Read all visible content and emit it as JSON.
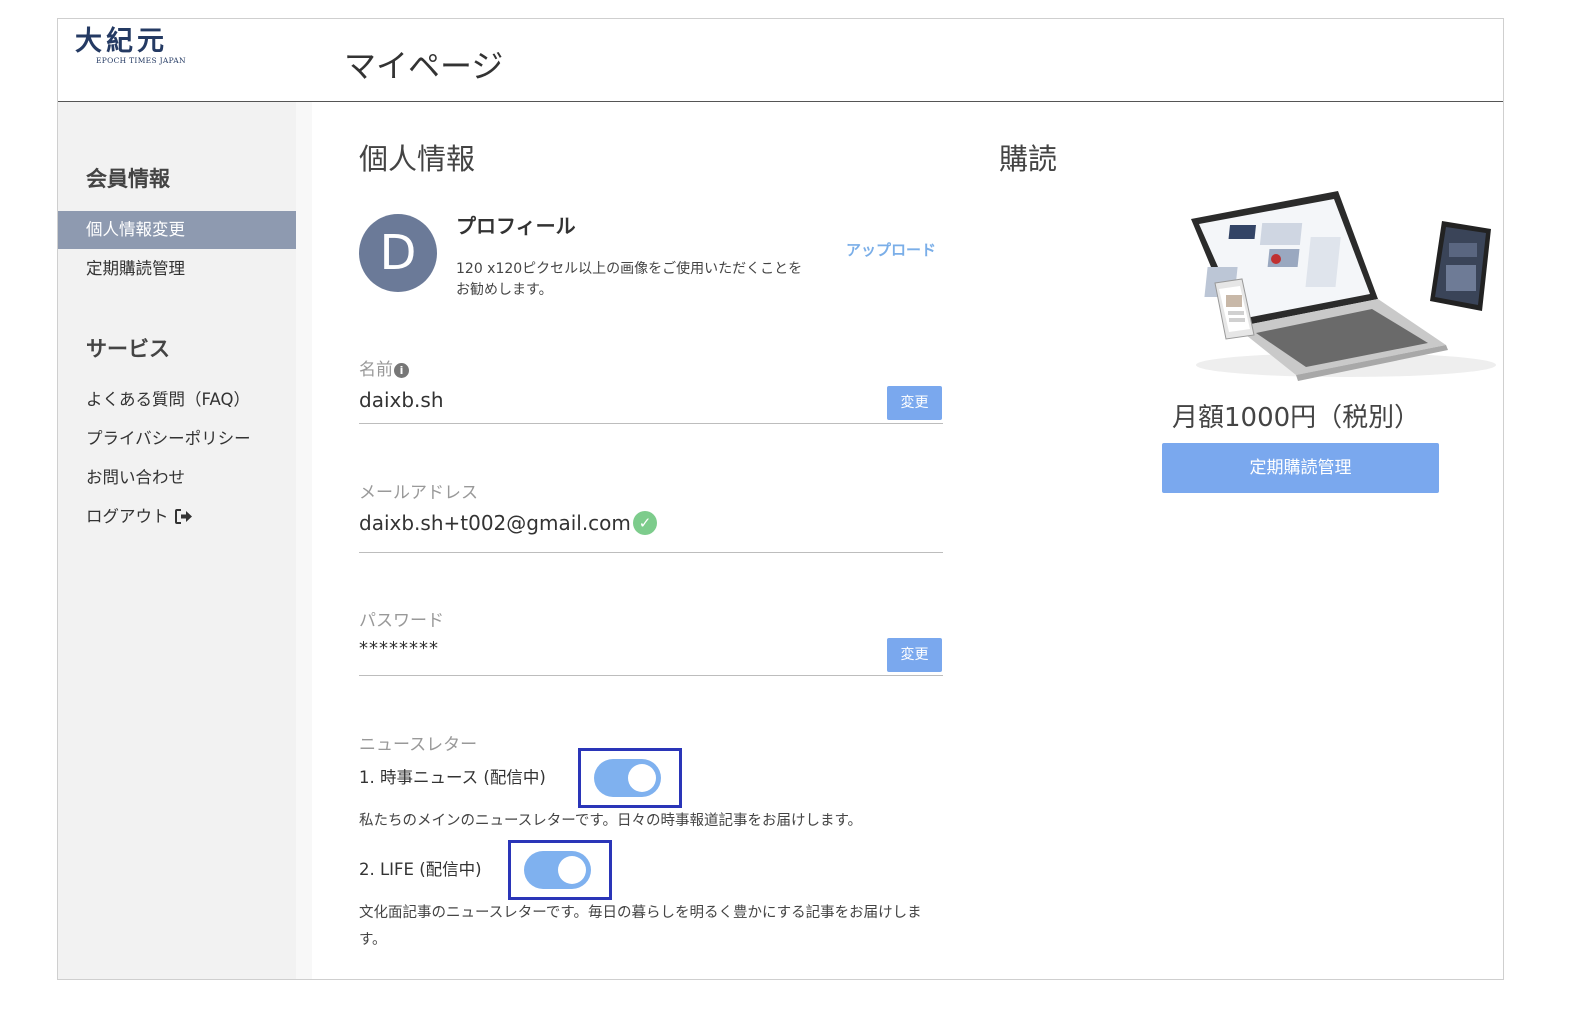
{
  "header": {
    "logo_text": "大紀元",
    "logo_subtext": "EPOCH TIMES JAPAN",
    "page_title": "マイページ"
  },
  "sidebar": {
    "member_heading": "会員情報",
    "member_items": [
      {
        "label": "個人情報変更",
        "active": true
      },
      {
        "label": "定期購読管理",
        "active": false
      }
    ],
    "service_heading": "サービス",
    "service_items": [
      {
        "label": "よくある質問（FAQ）"
      },
      {
        "label": "プライバシーポリシー"
      },
      {
        "label": "お問い合わせ"
      },
      {
        "label": "ログアウト"
      }
    ]
  },
  "personal": {
    "title": "個人情報",
    "avatar_letter": "D",
    "profile_title": "プロフィール",
    "profile_desc": "120 x120ピクセル以上の画像をご使用いただくことをお勧めします。",
    "upload_label": "アップロード",
    "name_label": "名前",
    "name_value": "daixb.sh",
    "change_label": "変更",
    "email_label": "メールアドレス",
    "email_value": "daixb.sh+t002@gmail.com",
    "password_label": "パスワード",
    "password_value": "********"
  },
  "newsletter": {
    "label": "ニュースレター",
    "items": [
      {
        "name": "1. 時事ニュース (配信中)",
        "desc": "私たちのメインのニュースレターです。日々の時事報道記事をお届けします。",
        "enabled": true
      },
      {
        "name": "2. LIFE (配信中)",
        "desc": "文化面記事のニュースレターです。毎日の暮らしを明るく豊かにする記事をお届けします。",
        "enabled": true
      }
    ]
  },
  "subscription": {
    "title": "購読",
    "price": "月額1000円（税別）",
    "button_label": "定期購読管理"
  },
  "colors": {
    "accent": "#7aa8ee",
    "sidebar_active": "#8e9ab0",
    "avatar": "#6b7a98",
    "verified": "#7dcc8c",
    "highlight_box": "#2a35b8"
  }
}
